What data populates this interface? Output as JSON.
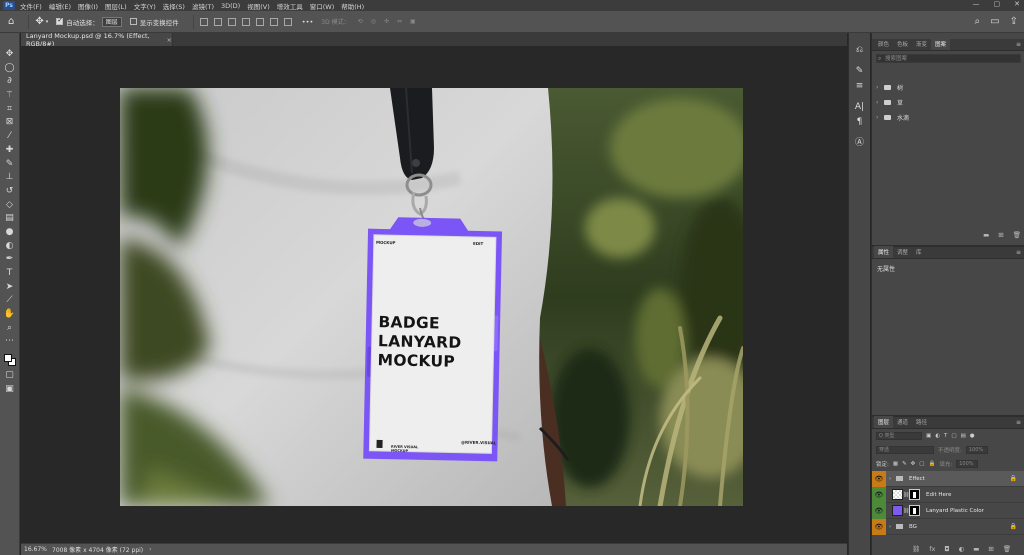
{
  "menubar": {
    "logo": "Ps",
    "items": [
      "文件(F)",
      "编辑(E)",
      "图像(I)",
      "图层(L)",
      "文字(Y)",
      "选择(S)",
      "滤镜(T)",
      "3D(D)",
      "视图(V)",
      "增效工具",
      "窗口(W)",
      "帮助(H)"
    ],
    "window_controls": [
      "—",
      "▢",
      "✕"
    ]
  },
  "options": {
    "auto_select_label": "自动选择：",
    "auto_select_checked": true,
    "target_value": "图层",
    "show_transform_label": "显示变换控件",
    "show_transform_checked": false,
    "more": "•••",
    "mode3d_label": "3D 模式："
  },
  "document": {
    "tab_title": "Lanyard Mockup.psd @ 16.7% (Effect, RGB/8#)",
    "close": "×"
  },
  "artwork": {
    "badge_title_lines": [
      "BADGE",
      "LANYARD",
      "MOCKUP"
    ],
    "badge_top_left": "MOCKUP",
    "badge_top_right": "EDIT",
    "badge_brand_lines": [
      "RIVER VISUAL",
      "MOCKUP"
    ],
    "badge_handle": "@RIVER.VISUAL",
    "colors": {
      "badge_holder": "#7b55f5",
      "card": "#eeeeee",
      "shirt": "#cfcfcf",
      "strap": "#1a1c1f"
    }
  },
  "status": {
    "zoom": "16.67%",
    "info": "7008 像素 x 4704 像素 (72 ppi)",
    "arrow": "›"
  },
  "panels": {
    "libraries": {
      "tabs": [
        "颜色",
        "色板",
        "渐变",
        "图案"
      ],
      "active_tab": 3,
      "search_placeholder": "搜索图案",
      "groups": [
        "树",
        "草",
        "水滴"
      ]
    },
    "properties": {
      "tabs": [
        "属性",
        "调整",
        "库"
      ],
      "active_tab": 0,
      "empty_text": "无属性"
    },
    "layers": {
      "tabs": [
        "图层",
        "通道",
        "路径"
      ],
      "active_tab": 0,
      "filter_kind": "Q 类型",
      "blend_mode": "穿透",
      "opacity_label": "不透明度:",
      "opacity_value": "100%",
      "lock_label": "锁定:",
      "fill_label": "填充:",
      "fill_value": "100%",
      "items": [
        {
          "name": "Effect",
          "type": "group",
          "eye": "orange",
          "locked": true,
          "selected": true
        },
        {
          "name": "Edit Here",
          "type": "smart",
          "eye": "green",
          "locked": false,
          "selected": false
        },
        {
          "name": "Lanyard Plastic Color",
          "type": "color",
          "eye": "green",
          "locked": false,
          "selected": false
        },
        {
          "name": "BG",
          "type": "group",
          "eye": "orange",
          "locked": true,
          "selected": false
        }
      ]
    }
  }
}
